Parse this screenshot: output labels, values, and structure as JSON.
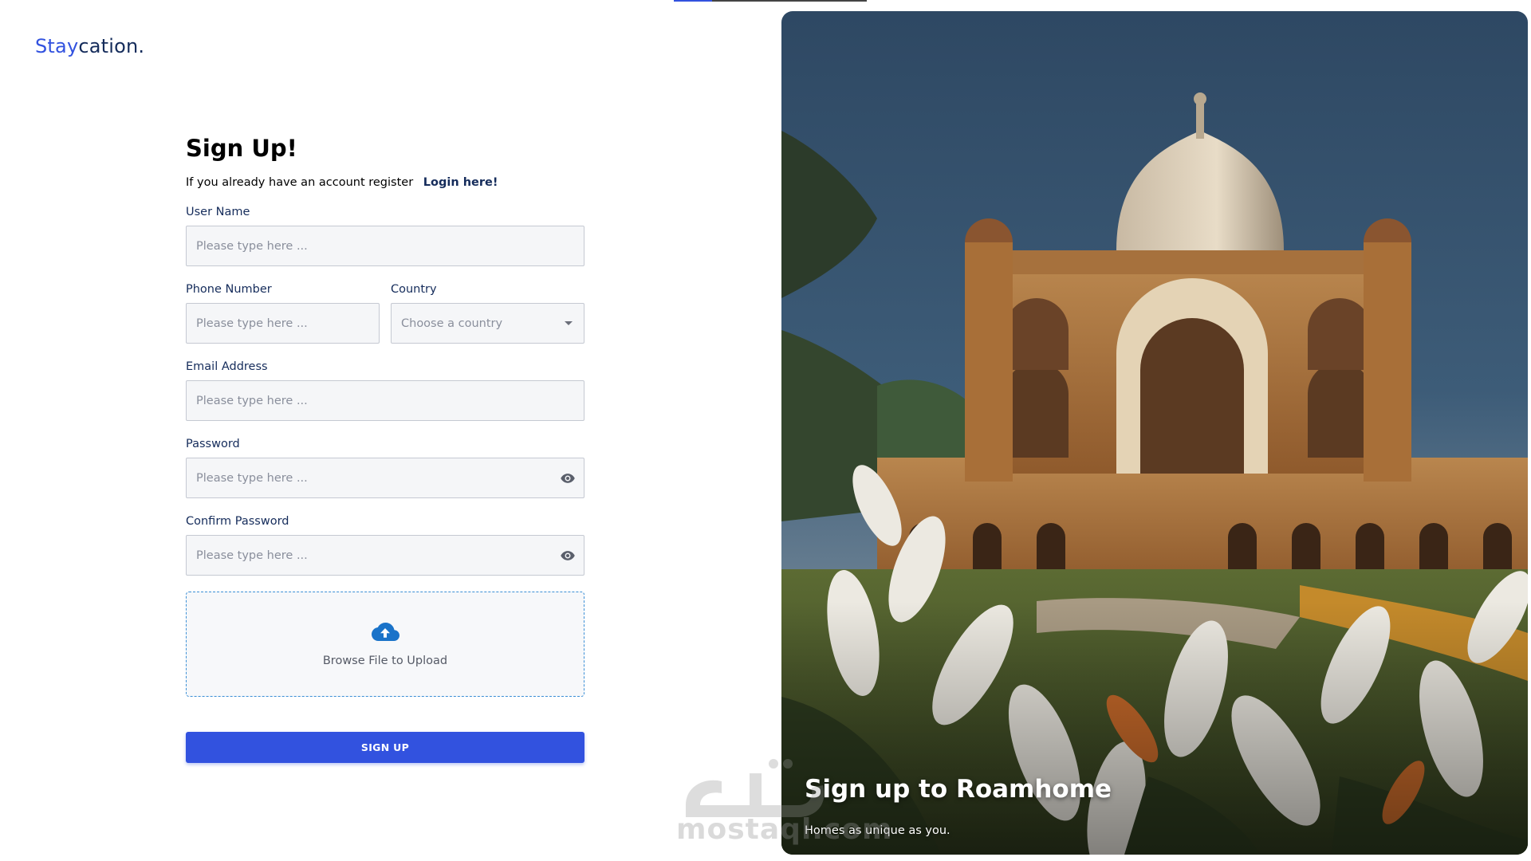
{
  "brand": {
    "logo_accent": "Stay",
    "logo_rest": "cation.",
    "accent_color": "#3252df",
    "text_color": "#152c5b"
  },
  "form": {
    "title": "Sign Up!",
    "subtitle": "If you already have an account register",
    "login_link": "Login here!",
    "fields": {
      "user_name": {
        "label": "User Name",
        "placeholder": "Please type here ..."
      },
      "phone": {
        "label": "Phone Number",
        "placeholder": "Please type here ..."
      },
      "country": {
        "label": "Country",
        "placeholder": "Choose a country"
      },
      "email": {
        "label": "Email Address",
        "placeholder": "Please type here ..."
      },
      "password": {
        "label": "Password",
        "placeholder": "Please type here ...",
        "icon": "eye-icon"
      },
      "confirm_password": {
        "label": "Confirm Password",
        "placeholder": "Please type here ...",
        "icon": "eye-icon"
      }
    },
    "upload": {
      "label": "Browse File to Upload",
      "icon": "cloud-upload-icon"
    },
    "submit_label": "SIGN UP"
  },
  "hero": {
    "title": "Sign up to Roamhome",
    "subtitle": "Homes as unique as you."
  },
  "watermark": {
    "text": "mostaql.com"
  }
}
